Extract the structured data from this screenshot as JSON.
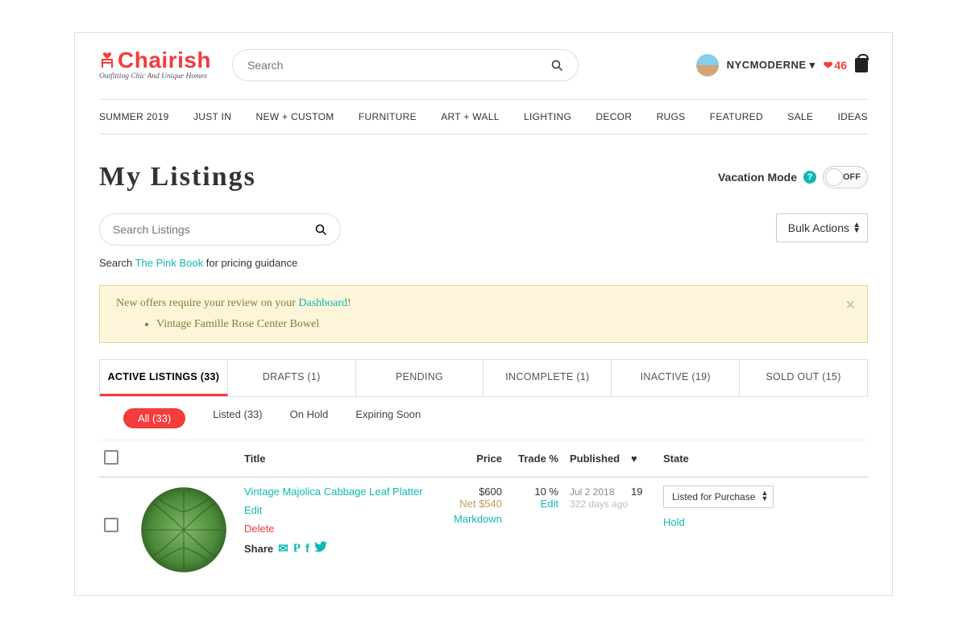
{
  "header": {
    "brand": "Chairish",
    "tagline": "Outfitting Chic And Unique Homes",
    "search_placeholder": "Search",
    "username": "NYCMODERNE",
    "favorites_count": "46"
  },
  "nav": [
    "SUMMER 2019",
    "JUST IN",
    "NEW + CUSTOM",
    "FURNITURE",
    "ART + WALL",
    "LIGHTING",
    "DECOR",
    "RUGS",
    "FEATURED",
    "SALE",
    "IDEAS"
  ],
  "page": {
    "title": "My Listings",
    "vacation_label": "Vacation Mode",
    "vacation_state": "OFF",
    "search_listings_placeholder": "Search Listings",
    "bulk_label": "Bulk Actions",
    "pinkbook_prefix": "Search ",
    "pinkbook_link": "The Pink Book",
    "pinkbook_suffix": " for pricing guidance"
  },
  "alert": {
    "message_prefix": "New offers require your review on your ",
    "dashboard_link": "Dashboard",
    "message_suffix": "!",
    "items": [
      "Vintage Famille Rose Center Bowel"
    ]
  },
  "tabs": [
    {
      "label": "ACTIVE LISTINGS (33)",
      "active": true
    },
    {
      "label": "DRAFTS (1)"
    },
    {
      "label": "PENDING"
    },
    {
      "label": "INCOMPLETE (1)"
    },
    {
      "label": "INACTIVE (19)"
    },
    {
      "label": "SOLD OUT (15)"
    }
  ],
  "subtabs": [
    {
      "label": "All (33)",
      "active": true
    },
    {
      "label": "Listed (33)"
    },
    {
      "label": "On Hold"
    },
    {
      "label": "Expiring Soon"
    }
  ],
  "columns": {
    "title": "Title",
    "price": "Price",
    "trade": "Trade %",
    "published": "Published",
    "heart": "♥",
    "state": "State"
  },
  "rows": [
    {
      "title": "Vintage Majolica Cabbage Leaf Platter",
      "edit": "Edit",
      "delete": "Delete",
      "share": "Share",
      "price": "$600",
      "net": "Net $540",
      "markdown": "Markdown",
      "trade": "10 %",
      "trade_edit": "Edit",
      "pub_date": "Jul 2 2018",
      "pub_ago": "322 days ago",
      "hearts": "19",
      "state": "Listed for Purchase",
      "hold": "Hold"
    }
  ]
}
